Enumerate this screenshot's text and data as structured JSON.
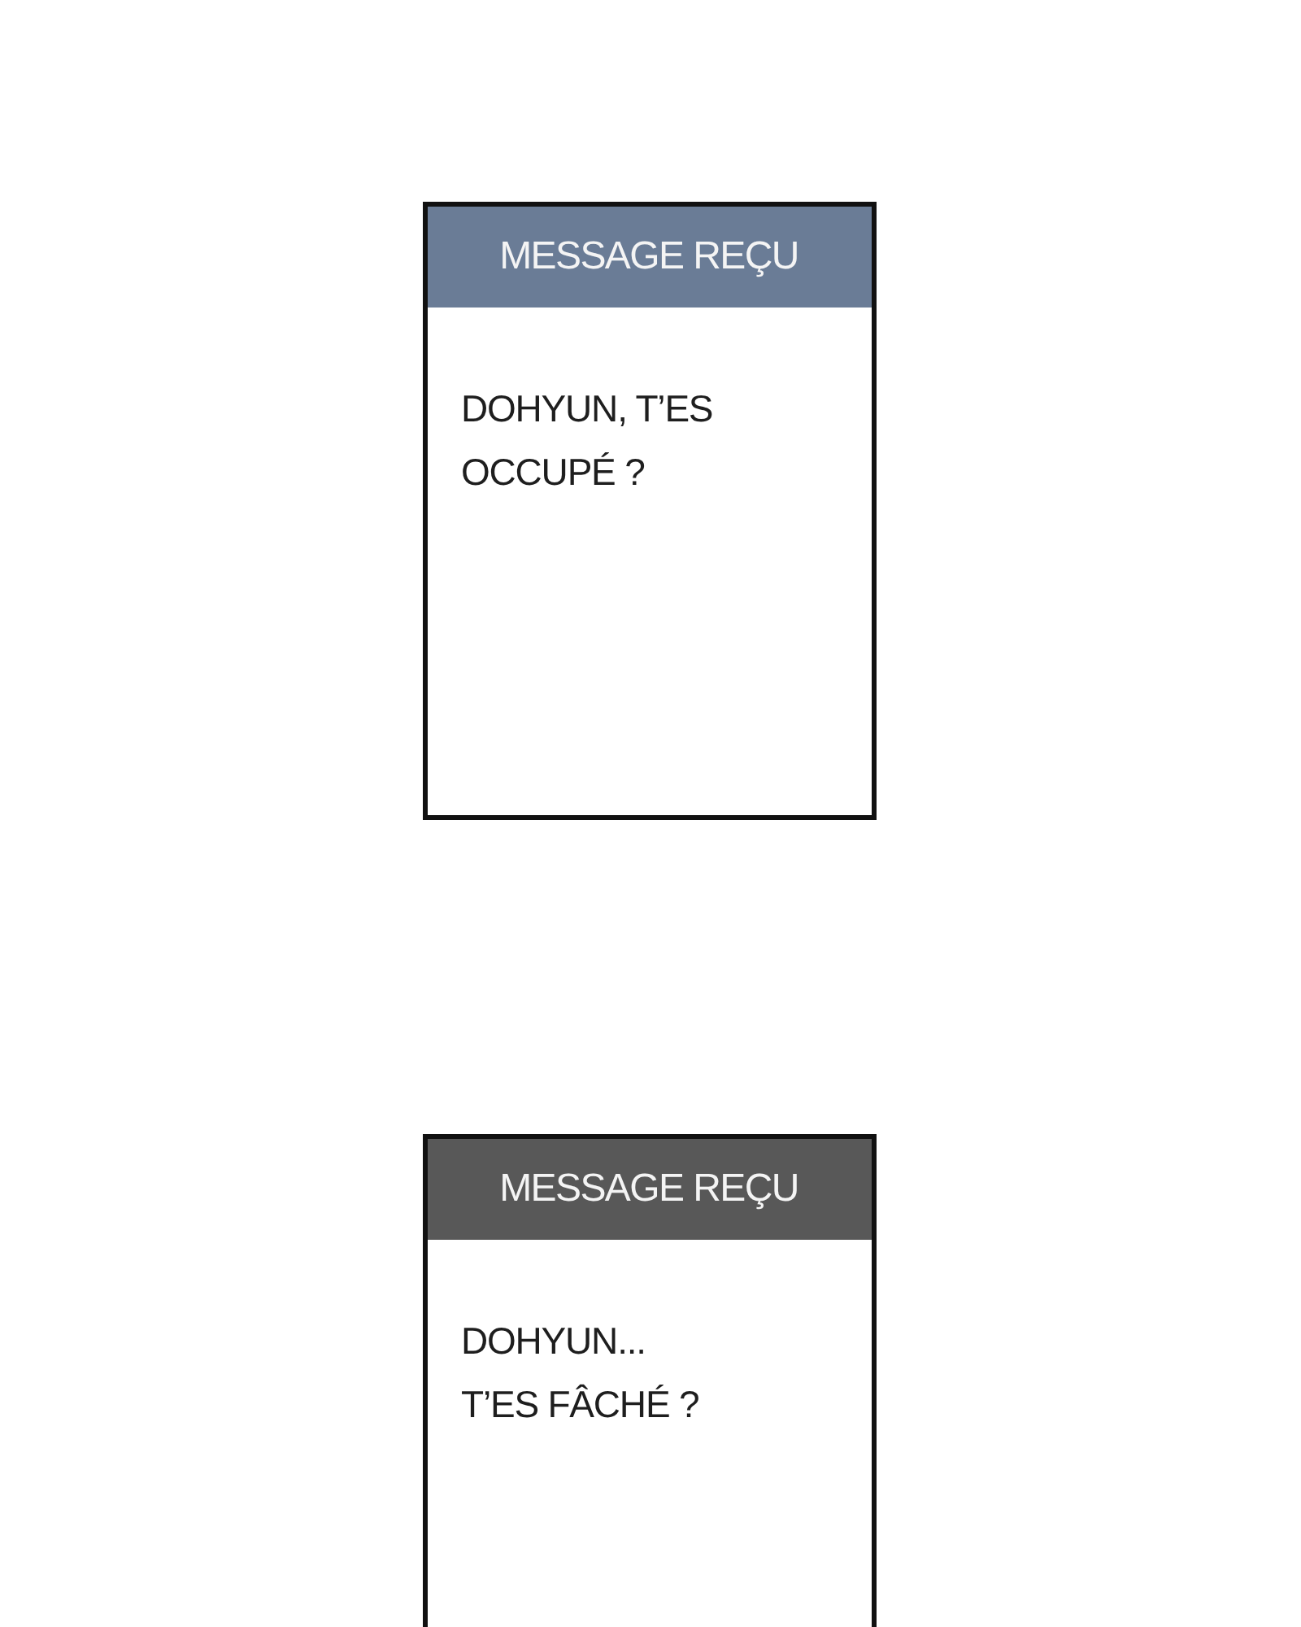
{
  "messages": [
    {
      "header": "MESSAGE REÇU",
      "color": "#6a7c96",
      "text": "DOHYUN, T’ES\nOCCUPÉ ?"
    },
    {
      "header": "MESSAGE REÇU",
      "color": "#585858",
      "text": "DOHYUN...\nT’ES FÂCHÉ ?"
    }
  ]
}
